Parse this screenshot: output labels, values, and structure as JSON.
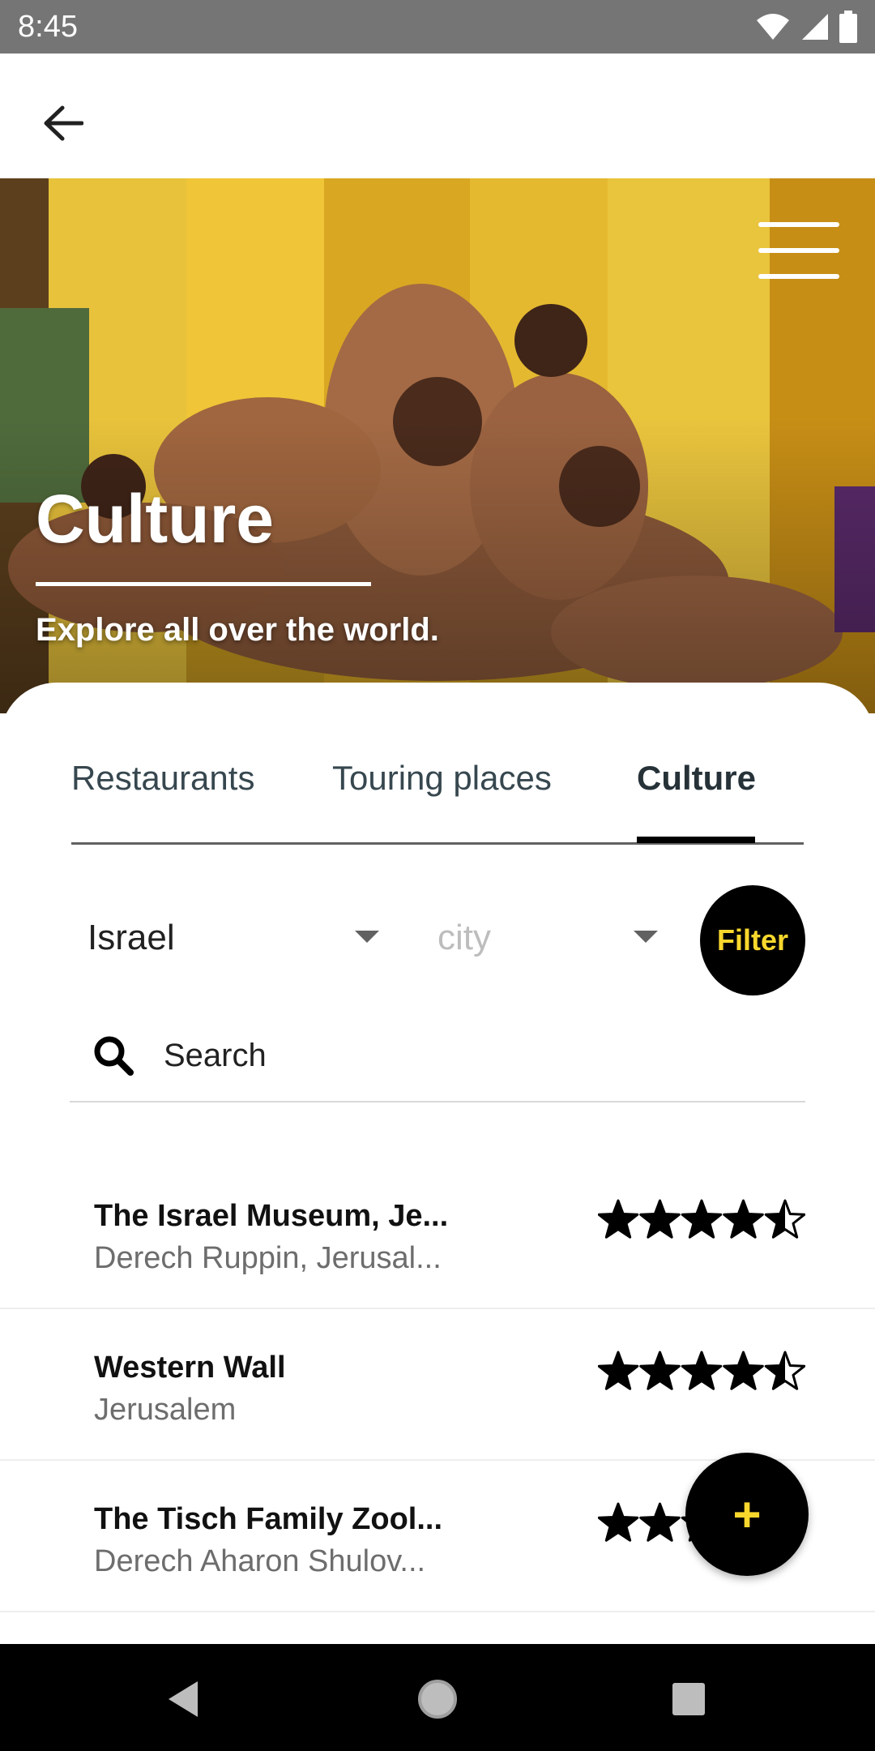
{
  "status_bar": {
    "time": "8:45",
    "icons": [
      "wifi-icon",
      "cellular-signal-icon",
      "battery-icon"
    ]
  },
  "app_bar": {
    "back_icon": "arrow-left-icon"
  },
  "hero": {
    "title": "Culture",
    "subtitle": "Explore all over the world.",
    "menu_icon": "hamburger-menu-icon"
  },
  "tabs": [
    {
      "label": "Restaurants",
      "active": false
    },
    {
      "label": "Touring places",
      "active": false
    },
    {
      "label": "Culture",
      "active": true
    }
  ],
  "filters": {
    "country_value": "Israel",
    "city_placeholder": "city",
    "filter_label": "Filter"
  },
  "search": {
    "label": "Search"
  },
  "places": [
    {
      "title": "The Israel Museum, Je...",
      "subtitle": "Derech Ruppin, Jerusal...",
      "rating": 4.5
    },
    {
      "title": "Western Wall",
      "subtitle": "Jerusalem",
      "rating": 4.5
    },
    {
      "title": "The Tisch Family Zool...",
      "subtitle": "Derech Aharon Shulov...",
      "rating": 4.5
    }
  ],
  "fab": {
    "label": "+"
  },
  "nav_bar": {
    "buttons": [
      "back-triangle-icon",
      "home-circle-icon",
      "recents-square-icon"
    ]
  },
  "colors": {
    "accent": "#f8d72d",
    "status_bar": "#757575",
    "nav_bar": "#000000"
  }
}
